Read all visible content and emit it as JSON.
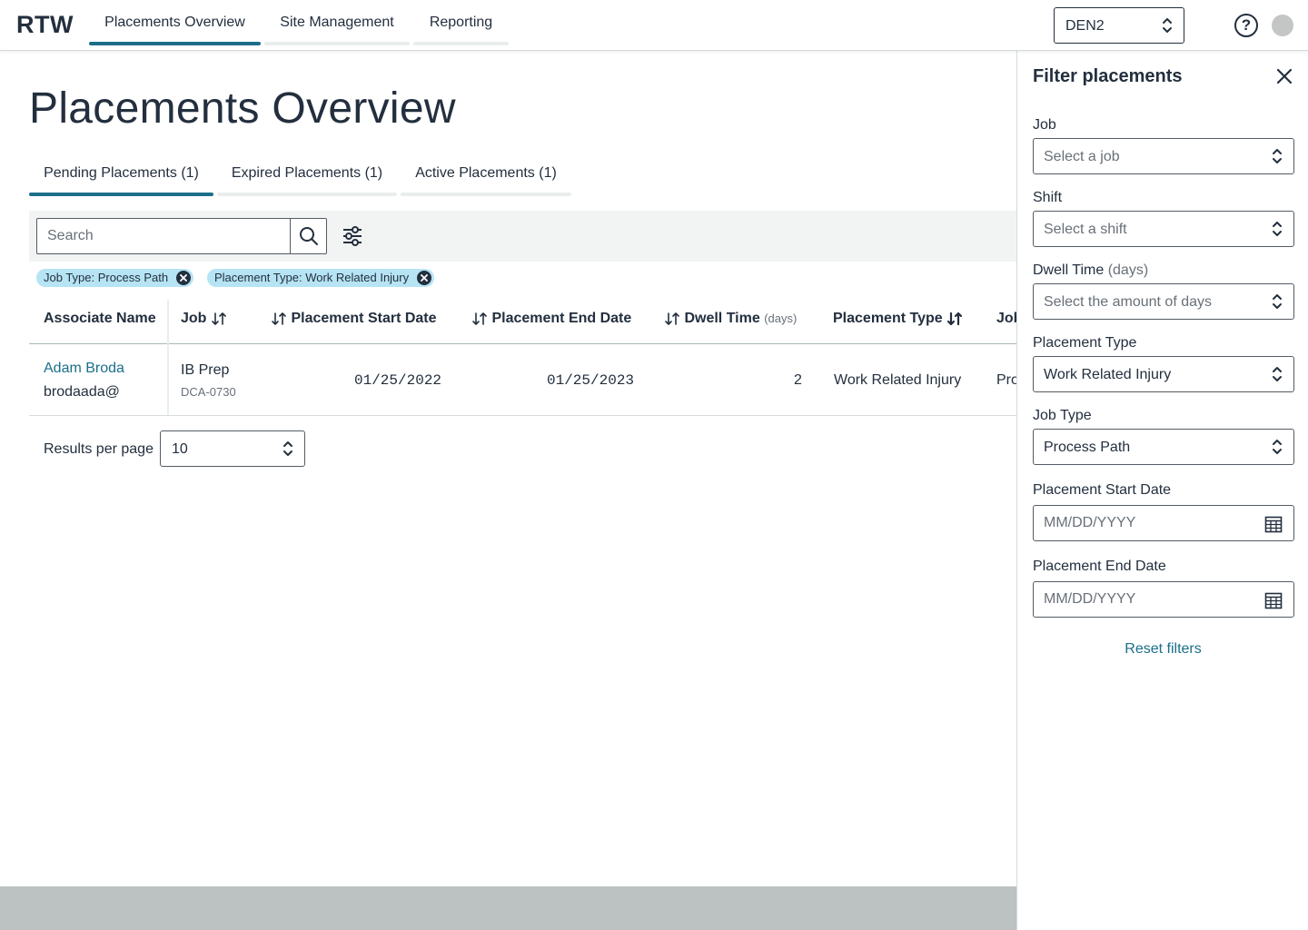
{
  "app": {
    "brand": "RTW"
  },
  "nav": {
    "tabs": [
      {
        "label": "Placements Overview",
        "active": true
      },
      {
        "label": "Site Management",
        "active": false
      },
      {
        "label": "Reporting",
        "active": false
      }
    ],
    "site": "DEN2"
  },
  "page": {
    "title": "Placements Overview",
    "tabs": [
      {
        "label": "Pending Placements (1)",
        "active": true
      },
      {
        "label": "Expired Placements (1)",
        "active": false
      },
      {
        "label": "Active Placements (1)",
        "active": false
      }
    ]
  },
  "search": {
    "placeholder": "Search"
  },
  "active_filters": [
    {
      "label": "Job Type: Process Path"
    },
    {
      "label": "Placement Type: Work Related Injury"
    }
  ],
  "table": {
    "columns": {
      "associate": "Associate Name",
      "job": "Job",
      "start": "Placement Start Date",
      "end": "Placement End Date",
      "dwell": "Dwell Time",
      "dwell_unit": "(days)",
      "ptype": "Placement Type",
      "jobtype": "Job"
    },
    "rows": [
      {
        "name": "Adam Broda",
        "login": "brodaada@",
        "job": "IB Prep",
        "job_code": "DCA-0730",
        "start": "01/25/2022",
        "end": "01/25/2023",
        "dwell": "2",
        "ptype": "Work Related Injury",
        "jobtype": "Pro"
      }
    ]
  },
  "pagination": {
    "label": "Results per page",
    "value": "10"
  },
  "filter_panel": {
    "title": "Filter placements",
    "job": {
      "label": "Job",
      "placeholder": "Select a job"
    },
    "shift": {
      "label": "Shift",
      "placeholder": "Select a shift"
    },
    "dwell": {
      "label": "Dwell Time",
      "unit": "(days)",
      "placeholder": "Select the amount of days"
    },
    "placement_type": {
      "label": "Placement Type",
      "value": "Work Related Injury"
    },
    "job_type": {
      "label": "Job Type",
      "value": "Process Path"
    },
    "start_date": {
      "label": "Placement Start Date",
      "placeholder": "MM/DD/YYYY"
    },
    "end_date": {
      "label": "Placement End Date",
      "placeholder": "MM/DD/YYYY"
    },
    "reset": "Reset filters"
  },
  "colors": {
    "accent": "#1b6e8a",
    "chip": "#b6e4f4",
    "text": "#232f3e",
    "toolbar": "#f2f3f3"
  },
  "icons": [
    "chevron-up-down-icon",
    "help-icon",
    "search-icon",
    "sliders-icon",
    "close-icon",
    "sort-icon",
    "calendar-icon"
  ]
}
